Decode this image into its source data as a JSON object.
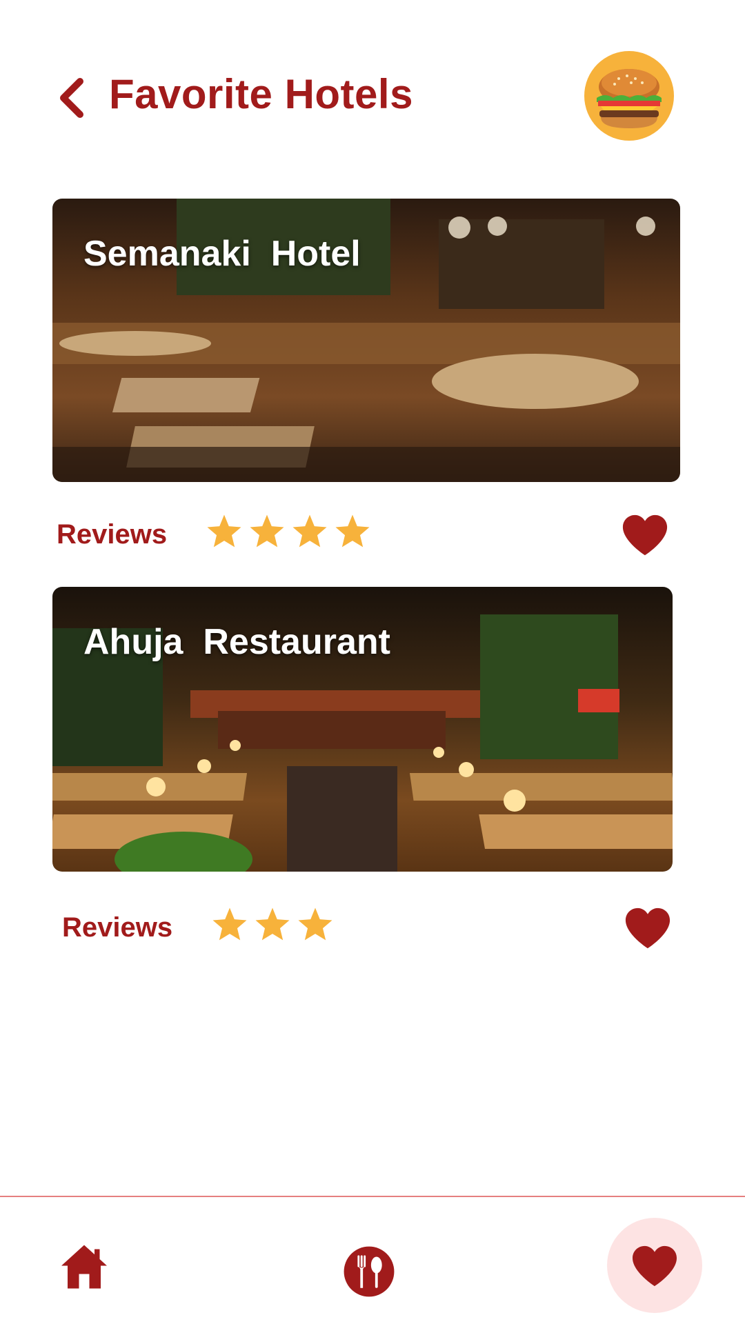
{
  "header": {
    "title": "Favorite Hotels",
    "back_icon": "chevron-left-icon",
    "avatar_icon": "burger-icon"
  },
  "favorites": [
    {
      "name": "Semanaki  Hotel",
      "reviews_label": "Reviews",
      "rating": 4,
      "favorited": true
    },
    {
      "name": "Ahuja  Restaurant",
      "reviews_label": "Reviews",
      "rating": 3,
      "favorited": true
    }
  ],
  "bottom_nav": {
    "items": [
      {
        "icon": "home-icon",
        "active": false
      },
      {
        "icon": "fork-spoon-icon",
        "active": false
      },
      {
        "icon": "heart-icon",
        "active": true
      }
    ]
  },
  "colors": {
    "brand": "#a11b1b",
    "star": "#f7b23b",
    "active_nav_bg": "#fde3e3",
    "divider": "#e57f7f"
  }
}
